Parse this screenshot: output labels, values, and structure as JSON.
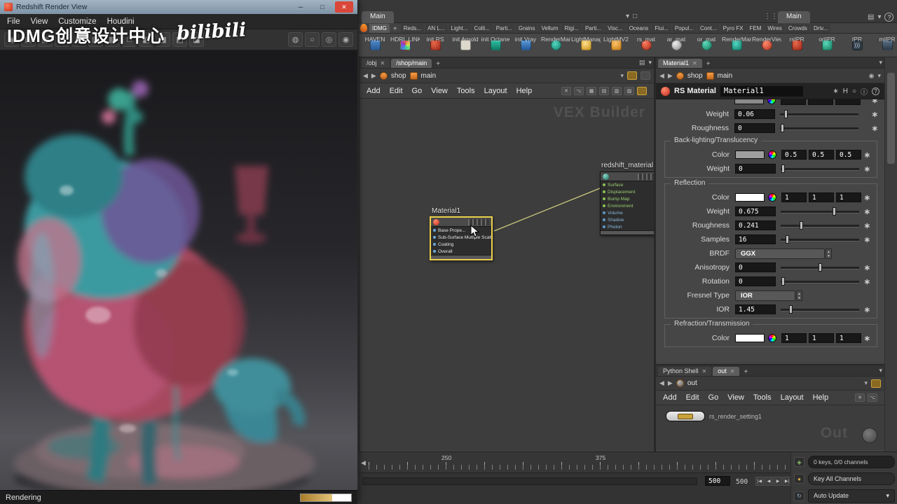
{
  "icons": {
    "minimize": "─",
    "maximize": "□",
    "close": "✕",
    "chevron_down": "▾",
    "back": "◀",
    "forward": "▶",
    "plus": "+",
    "star": "∗",
    "help": "?",
    "pin": "◉",
    "step_prev": "|◀",
    "prev": "◀",
    "next": "▶",
    "step_next": "▶|"
  },
  "colors": {
    "selection_yellow": "#ecd04c",
    "houdini_orange": "#f2a04a",
    "progress_orange": "#d9a94e"
  },
  "render_view": {
    "title": "Redshift Render View",
    "menu": [
      "File",
      "View",
      "Customize",
      "Houdini"
    ],
    "watermark": "IDMG创意设计中心",
    "logo": "bilibili",
    "status": "Rendering"
  },
  "top": {
    "left_pane_tab": "Main",
    "right_pane_tab": "Main"
  },
  "shelf": {
    "active_tab": "IDMG",
    "tabs": [
      "Reds...",
      "AN L...",
      "Light...",
      "Colli...",
      "Parti...",
      "Grains",
      "Vellum",
      "Rigi...",
      "Parti...",
      "Visc...",
      "Oceans",
      "Flui...",
      "Popul...",
      "Cont...",
      "Pyro FX",
      "FEM",
      "Wires",
      "Crowds",
      "Driv..."
    ],
    "tools": [
      {
        "label": "HAVEN",
        "icon": "haven-icon"
      },
      {
        "label": "HDRI_LINK",
        "icon": "hdri-link-icon"
      },
      {
        "label": "init RS",
        "icon": "init-rs-icon"
      },
      {
        "label": "init Arnold",
        "icon": "init-arnold-icon"
      },
      {
        "label": "init Octane",
        "icon": "init-octane-icon"
      },
      {
        "label": "init Vray",
        "icon": "init-vray-icon"
      },
      {
        "label": "RenderMan",
        "icon": "renderman-icon"
      },
      {
        "label": "LightManager",
        "icon": "lightmanager-icon"
      },
      {
        "label": "LightMV2",
        "icon": "lightmv2-icon"
      },
      {
        "label": "rs_mat",
        "icon": "rs-mat-icon"
      },
      {
        "label": "ar_mat",
        "icon": "ar-mat-icon"
      },
      {
        "label": "or_mat",
        "icon": "or-mat-icon"
      },
      {
        "label": "RenderMan Preset Brow...",
        "icon": "renderman-preset-icon"
      },
      {
        "label": "RenderView",
        "icon": "renderview-icon"
      },
      {
        "label": "rsIPR",
        "icon": "rs-ipr-icon"
      },
      {
        "label": "oriIPR",
        "icon": "ori-ipr-icon"
      },
      {
        "label": "IPR",
        "icon": "ipr-icon"
      },
      {
        "label": "miIPR",
        "icon": "mi-ipr-icon"
      }
    ]
  },
  "network": {
    "tabs": [
      "/obj",
      "/shop/main"
    ],
    "path": [
      "shop",
      "main"
    ],
    "menu": [
      "Add",
      "Edit",
      "Go",
      "View",
      "Tools",
      "Layout",
      "Help"
    ],
    "watermark": "VEX Builder",
    "material_node": {
      "name": "Material1",
      "items": [
        "Base Prope...",
        "Sub-Surface Multiple Scatt...",
        "Coating",
        "Overall"
      ]
    },
    "redshift_node": {
      "name": "redshift_material",
      "items": [
        "Surface",
        "Displacement",
        "Bump Map",
        "Environment",
        "Volume",
        "Shadow",
        "Photon"
      ]
    }
  },
  "params": {
    "tab": "Material1",
    "path": [
      "shop",
      "main"
    ],
    "header": {
      "type": "RS Material",
      "name": "Material1"
    },
    "rows": {
      "weight": {
        "label": "Weight",
        "value": "0.06"
      },
      "roughness": {
        "label": "Roughness",
        "value": "0"
      },
      "backlighting": {
        "title": "Back-lighting/Translucency",
        "color": {
          "label": "Color",
          "r": "0.5",
          "g": "0.5",
          "b": "0.5",
          "swatch": "#9e9e9e"
        },
        "weight": {
          "label": "Weight",
          "value": "0"
        }
      },
      "reflection": {
        "title": "Reflection",
        "color": {
          "label": "Color",
          "r": "1",
          "g": "1",
          "b": "1",
          "swatch": "#ffffff"
        },
        "weight": {
          "label": "Weight",
          "value": "0.675"
        },
        "roughness": {
          "label": "Roughness",
          "value": "0.241"
        },
        "samples": {
          "label": "Samples",
          "value": "16"
        },
        "brdf": {
          "label": "BRDF",
          "value": "GGX"
        },
        "anisotropy": {
          "label": "Anisotropy",
          "value": "0"
        },
        "rotation": {
          "label": "Rotation",
          "value": "0"
        },
        "fresnel": {
          "label": "Fresnel Type",
          "value": "IOR"
        },
        "ior": {
          "label": "IOR",
          "value": "1.45"
        }
      },
      "refraction": {
        "title": "Refraction/Transmission",
        "color": {
          "label": "Color",
          "r": "1",
          "g": "1",
          "b": "1",
          "swatch": "#ffffff"
        }
      }
    }
  },
  "out": {
    "tabs": [
      "Python Shell",
      "out"
    ],
    "path": "out",
    "menu": [
      "Add",
      "Edit",
      "Go",
      "View",
      "Tools",
      "Layout",
      "Help"
    ],
    "node": "rs_render_setting1",
    "watermark": "Out"
  },
  "timeline": {
    "labels": [
      "250",
      "375"
    ]
  },
  "playbar": {
    "frame": "500",
    "end": "500"
  },
  "bottom_right": {
    "keys": "0 keys, 0/0 channels",
    "key_all": "Key All Channels",
    "auto_update": "Auto Update"
  }
}
